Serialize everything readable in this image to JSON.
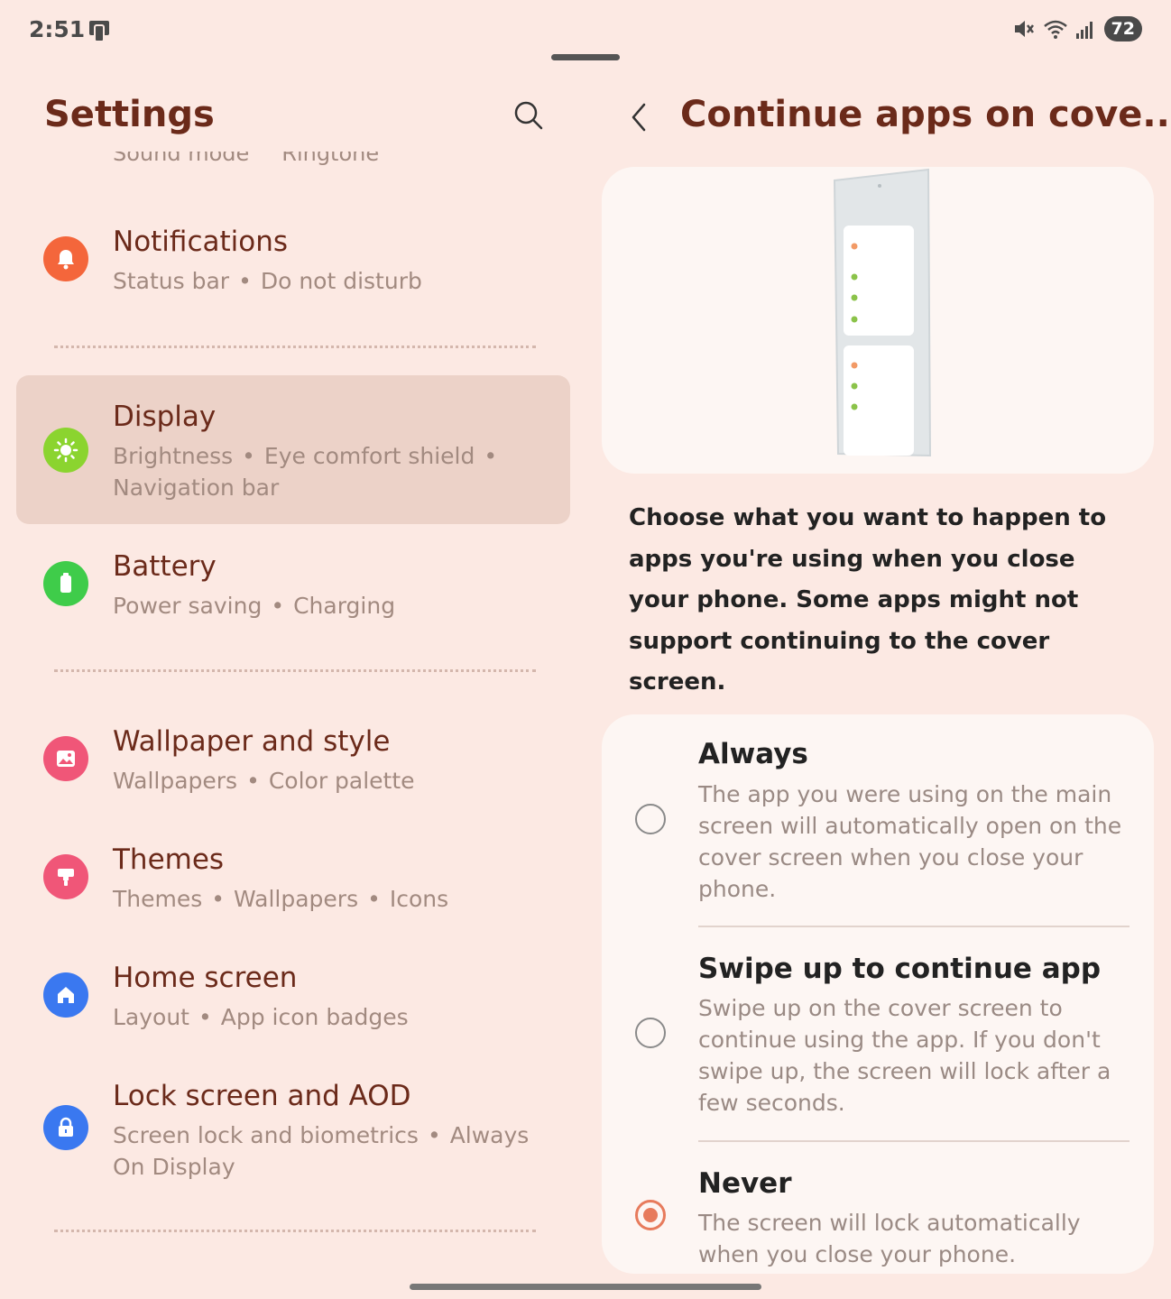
{
  "status_bar": {
    "time": "2:51",
    "battery": "72",
    "icons": [
      "phone-icon",
      "mute-icon",
      "wifi-icon",
      "signal-icon"
    ]
  },
  "left": {
    "title": "Settings",
    "clipped_item": [
      "Sound mode",
      "Ringtone"
    ],
    "items": [
      {
        "title": "Notifications",
        "subs": [
          "Status bar",
          "Do not disturb"
        ],
        "icon": "bell-icon",
        "color": "#f4663b"
      },
      {
        "title": "Display",
        "subs": [
          "Brightness",
          "Eye comfort shield",
          "Navigation bar"
        ],
        "icon": "sun-icon",
        "color": "#8bd42f"
      },
      {
        "title": "Battery",
        "subs": [
          "Power saving",
          "Charging"
        ],
        "icon": "battery-icon",
        "color": "#3fcc4a"
      },
      {
        "title": "Wallpaper and style",
        "subs": [
          "Wallpapers",
          "Color palette"
        ],
        "icon": "image-icon",
        "color": "#f05678"
      },
      {
        "title": "Themes",
        "subs": [
          "Themes",
          "Wallpapers",
          "Icons"
        ],
        "icon": "brush-icon",
        "color": "#f05678"
      },
      {
        "title": "Home screen",
        "subs": [
          "Layout",
          "App icon badges"
        ],
        "icon": "home-icon",
        "color": "#3a78f0"
      },
      {
        "title": "Lock screen and AOD",
        "subs": [
          "Screen lock and biometrics",
          "Always On Display"
        ],
        "icon": "lock-icon",
        "color": "#3a78f0"
      }
    ]
  },
  "right": {
    "title": "Continue apps on cove...",
    "description": "Choose what you want to happen to apps you're using when you close your phone. Some apps might not support continuing to the cover screen.",
    "options": [
      {
        "title": "Always",
        "desc": "The app you were using on the main screen will automatically open on the cover screen when you close your phone.",
        "selected": false
      },
      {
        "title": "Swipe up to continue app",
        "desc": "Swipe up on the cover screen to continue using the app. If you don't swipe up, the screen will lock after a few seconds.",
        "selected": false
      },
      {
        "title": "Never",
        "desc": "The screen will lock automatically when you close your phone.",
        "selected": true
      }
    ],
    "accent_color": "#e77b5c"
  }
}
